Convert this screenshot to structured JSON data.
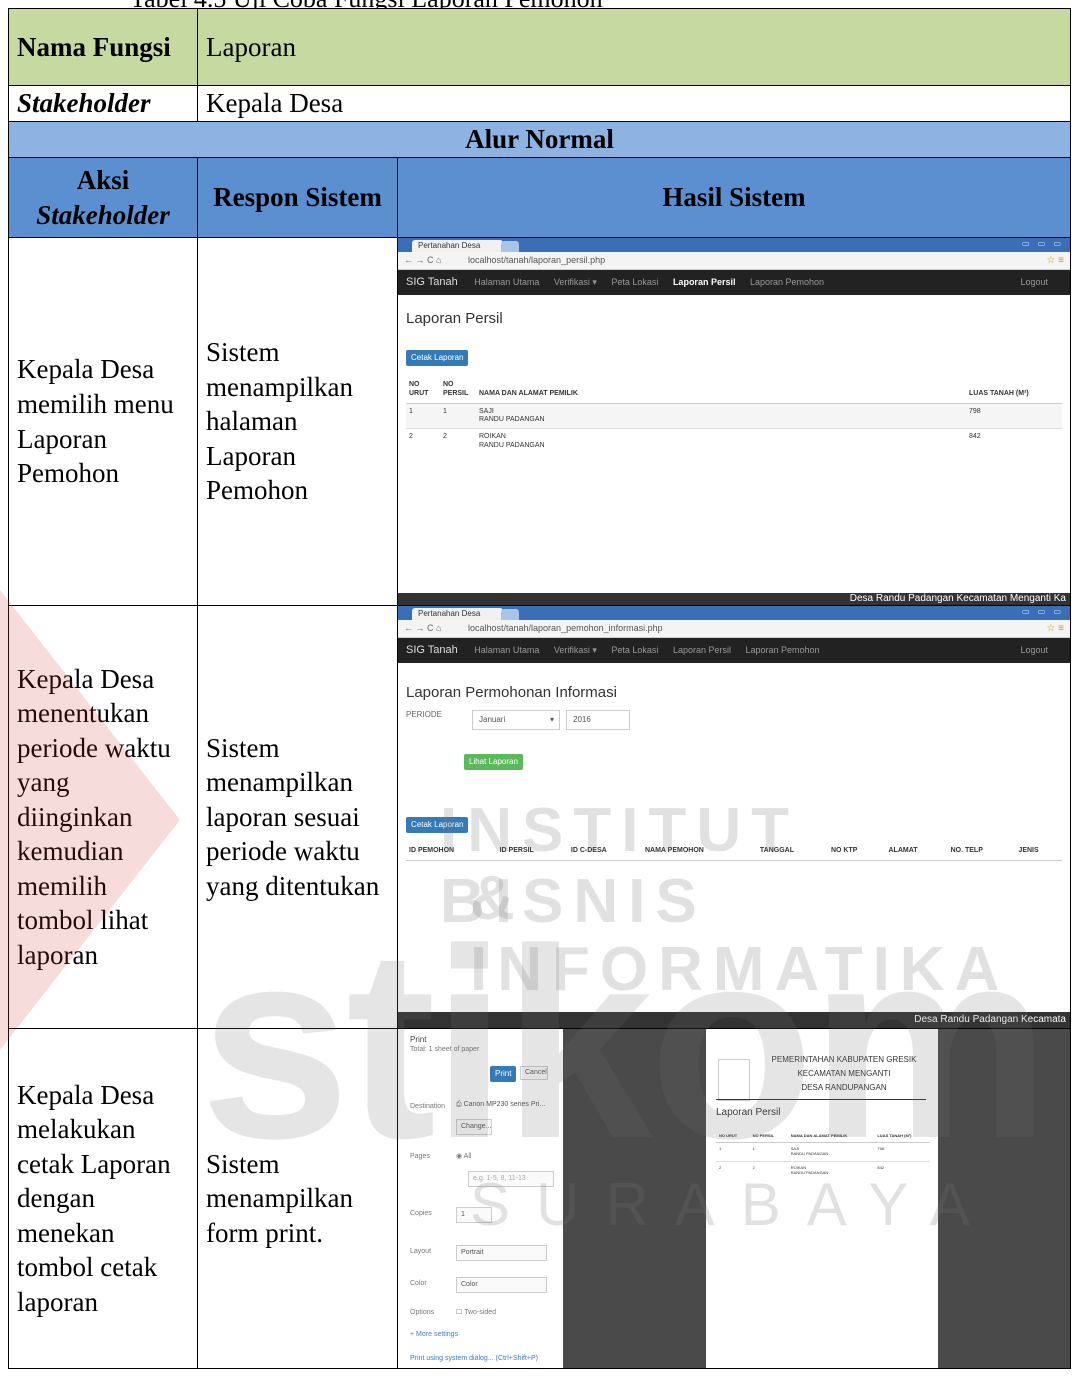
{
  "cut_title": "Tabel 4.5 Uji Coba Fungsi Laporan Pemohon",
  "rows": {
    "nama_fungsi_label": "Nama Fungsi",
    "nama_fungsi_value": "Laporan",
    "stakeholder_label": "Stakeholder",
    "stakeholder_value": "Kepala Desa",
    "alur_normal": "Alur Normal",
    "col_aksi": "Aksi",
    "col_aksi_sub": "Stakeholder",
    "col_respon": "Respon Sistem",
    "col_hasil": "Hasil Sistem"
  },
  "steps": [
    {
      "aksi": "Kepala Desa memilih menu Laporan Pemohon",
      "respon": "Sistem menampilkan halaman Laporan Pemohon"
    },
    {
      "aksi": "Kepala Desa menentukan periode waktu yang diinginkan kemudian memilih tombol lihat laporan",
      "respon": "Sistem menampilkan laporan sesuai periode waktu yang ditentukan"
    },
    {
      "aksi": "Kepala Desa melakukan cetak Laporan dengan menekan tombol cetak laporan",
      "respon": "Sistem menampilkan form print."
    }
  ],
  "shot1": {
    "tab": "Pertanahan Desa",
    "url": "localhost/tanah/laporan_persil.php",
    "brand": "SIG Tanah",
    "nav": [
      "Halaman Utama",
      "Verifikasi ▾",
      "Peta Lokasi",
      "Laporan Persil",
      "Laporan Pemohon"
    ],
    "logout": "Logout",
    "title": "Laporan Persil",
    "button": "Cetak Laporan",
    "headers": [
      "NO URUT",
      "NO PERSIL",
      "NAMA DAN ALAMAT PEMILIK",
      "LUAS TANAH (M²)"
    ],
    "rows": [
      [
        "1",
        "1",
        "SAJI",
        "RANDU PADANGAN",
        "798"
      ],
      [
        "2",
        "2",
        "ROIKAN",
        "RANDU PADANGAN",
        "842"
      ]
    ],
    "footer": "Desa Randu Padangan Kecamatan Menganti  Ka"
  },
  "shot2": {
    "tab": "Pertanahan Desa",
    "url": "localhost/tanah/laporan_pemohon_informasi.php",
    "brand": "SIG Tanah",
    "nav": [
      "Halaman Utama",
      "Verifikasi ▾",
      "Peta Lokasi",
      "Laporan Persil",
      "Laporan Pemohon"
    ],
    "logout": "Logout",
    "title": "Laporan Permohonan Informasi",
    "periode_label": "PERIODE",
    "month": "Januari",
    "year": "2016",
    "view_button": "Lihat Laporan",
    "print_button": "Cetak Laporan",
    "headers": [
      "ID PEMOHON",
      "ID PERSIL",
      "ID C-DESA",
      "NAMA PEMOHON",
      "TANGGAL",
      "NO KTP",
      "ALAMAT",
      "NO. TELP",
      "JENIS"
    ],
    "footer": "Desa Randu Padangan Kecamata"
  },
  "shot3": {
    "print_title": "Print",
    "sheets": "Total: 1 sheet of paper",
    "print_btn": "Print",
    "cancel_btn": "Cancel",
    "destination_label": "Destination",
    "destination_value": "Canon MP230 series Pri...",
    "change_btn": "Change...",
    "pages_label": "Pages",
    "pages_all": "All",
    "pages_placeholder": "e.g. 1-5, 8, 11-13",
    "copies_label": "Copies",
    "copies_value": "1",
    "layout_label": "Layout",
    "layout_value": "Portrait",
    "color_label": "Color",
    "color_value": "Color",
    "options_label": "Options",
    "options_value": "Two-sided",
    "more_settings": "More settings",
    "system_dialog": "Print using system dialog... (Ctrl+Shift+P)",
    "paper_heading1": "PEMERINTAHAN KABUPATEN GRESIK",
    "paper_heading2": "KECAMATAN MENGANTI",
    "paper_heading3": "DESA RANDUPANGAN",
    "paper_title": "Laporan Persil",
    "paper_headers": [
      "NO URUT",
      "NO PERSIL",
      "NAMA DAN ALAMAT PEMILIK",
      "LUAS TANAH (M²)"
    ],
    "paper_rows": [
      [
        "1",
        "1",
        "SAJI",
        "RANDU PADANGAN",
        "798"
      ],
      [
        "2",
        "2",
        "ROIKAN",
        "RANDU PADANGAN",
        "842"
      ]
    ]
  },
  "watermark": {
    "line1": "INSTITUT BISNIS",
    "line2": "& INFORMATIKA",
    "brand": "stikom",
    "city": "SURABAYA"
  }
}
